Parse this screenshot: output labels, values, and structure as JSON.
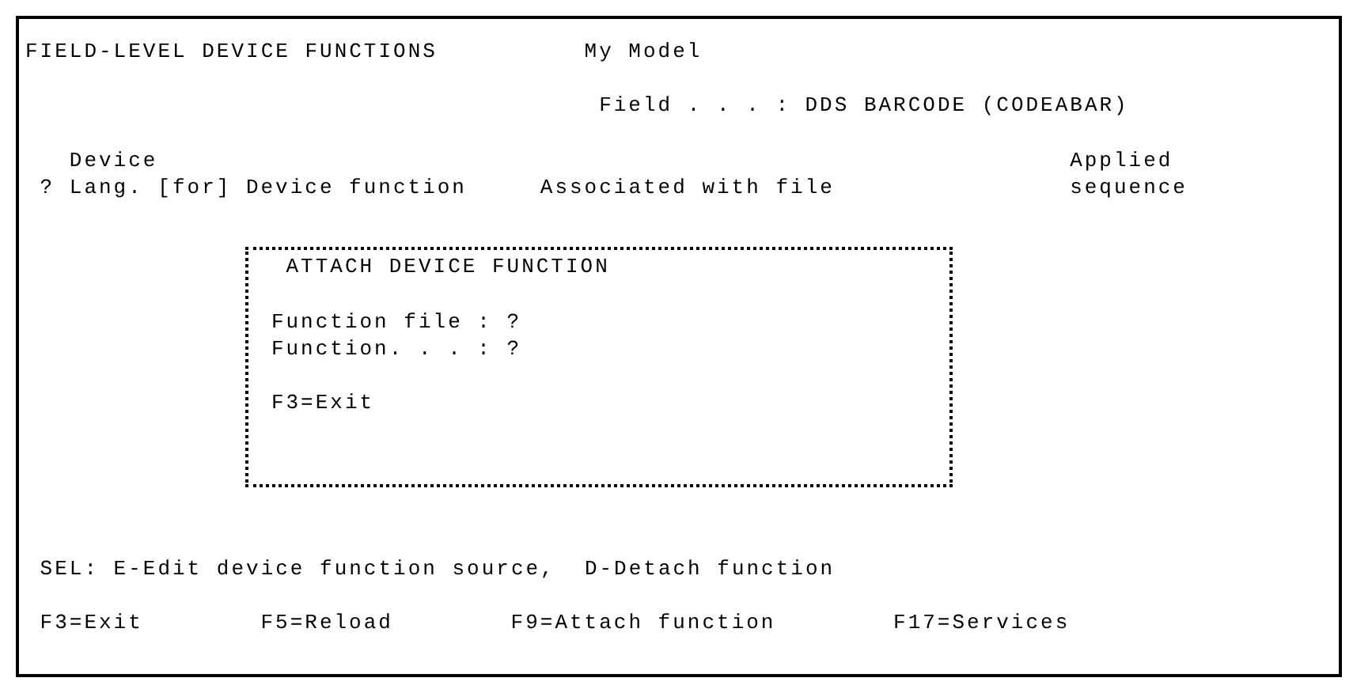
{
  "screen": {
    "title": "FIELD-LEVEL DEVICE FUNCTIONS",
    "model": "My Model",
    "field_label": "Field . . . :",
    "field_value": "DDS BARCODE (CODEABAR)"
  },
  "columns": [
    {
      "lines": [
        "?"
      ]
    },
    {
      "lines": [
        "Device",
        "Lang."
      ]
    },
    {
      "lines": [
        "[for]"
      ]
    },
    {
      "lines": [
        "Device function"
      ]
    },
    {
      "lines": [
        "Associated with file"
      ]
    },
    {
      "lines": [
        "Applied",
        "sequence"
      ]
    }
  ],
  "popup": {
    "title": "ATTACH DEVICE FUNCTION",
    "fields": [
      {
        "label": "Function file :",
        "value": "?"
      },
      {
        "label": "Function. . . :",
        "value": "?"
      }
    ],
    "keys": [
      "F3=Exit"
    ]
  },
  "selection_help": "SEL: E-Edit device function source,  D-Detach function",
  "function_keys": [
    "F3=Exit",
    "F5=Reload",
    "F9=Attach function",
    "F17=Services"
  ]
}
